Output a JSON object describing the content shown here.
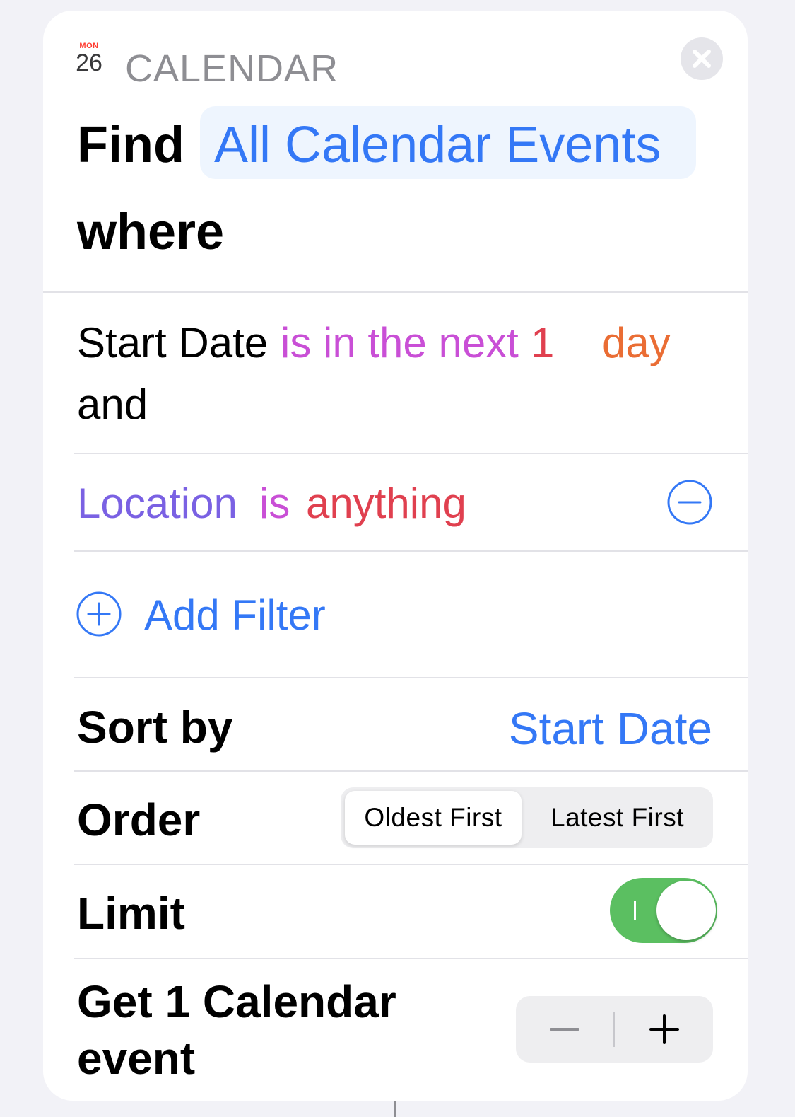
{
  "header": {
    "icon_month": "MON",
    "icon_day": "26",
    "app_name": "CALENDAR"
  },
  "action": {
    "find_label": "Find",
    "scope": "All Calendar Events",
    "where_label": "where"
  },
  "filters": [
    {
      "field": "Start Date",
      "operator": "is in the next",
      "number": "1",
      "unit": "day",
      "conjunction": "and"
    },
    {
      "field": "Location",
      "operator": "is",
      "value": "anything"
    }
  ],
  "add_filter_label": "Add Filter",
  "sort": {
    "label": "Sort by",
    "value": "Start Date"
  },
  "order": {
    "label": "Order",
    "options": [
      "Oldest First",
      "Latest First"
    ],
    "selected": "Oldest First"
  },
  "limit": {
    "label": "Limit",
    "enabled": true
  },
  "get": {
    "label": "Get 1 Calendar event"
  },
  "colors": {
    "accent": "#3478f6",
    "toggle_on": "#5bbf61",
    "field_purple": "#7a61e3",
    "operator_magenta": "#c94fd6",
    "value_red": "#e0404f",
    "unit_orange": "#ea6d34"
  },
  "icons": {
    "close": "close-icon",
    "remove": "minus-circle-icon",
    "add": "plus-circle-icon",
    "stepper_minus": "minus-icon",
    "stepper_plus": "plus-icon",
    "app": "calendar-app-icon"
  }
}
